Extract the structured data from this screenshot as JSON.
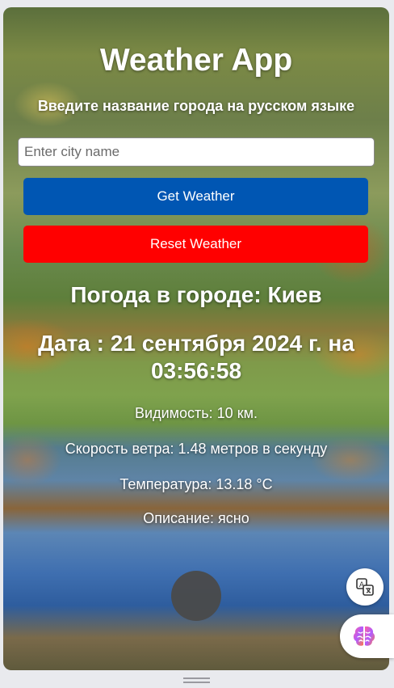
{
  "app": {
    "title": "Weather App",
    "subtitle": "Введите название города на русском языке"
  },
  "search": {
    "placeholder": "Enter city name",
    "value": ""
  },
  "buttons": {
    "get_label": "Get Weather",
    "reset_label": "Reset Weather"
  },
  "weather": {
    "city_line": "Погода в городе: Киев",
    "date_line": "Дата : 21 сентября 2024 г. на 03:56:58",
    "visibility": "Видимость: 10 км.",
    "wind": "Скорость ветра: 1.48 метров в секунду",
    "temperature": "Температура: 13.18 °C",
    "description": "Описание: ясно"
  },
  "colors": {
    "get_button": "#0056b3",
    "reset_button": "#ff0000",
    "text": "#ffffff"
  },
  "icons": {
    "translate": "translate-icon",
    "brain": "brain-icon"
  }
}
